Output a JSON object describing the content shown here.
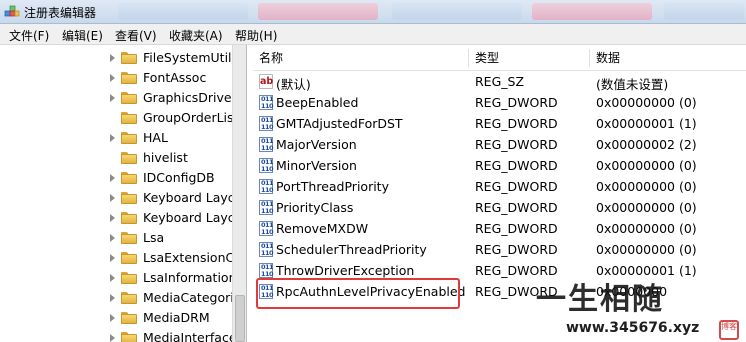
{
  "window": {
    "title": "注册表编辑器",
    "icon": "regedit-icon"
  },
  "menu": [
    "文件(F)",
    "编辑(E)",
    "查看(V)",
    "收藏夹(A)",
    "帮助(H)"
  ],
  "tree": {
    "items": [
      {
        "label": "FileSystemUtilit",
        "has_children": true
      },
      {
        "label": "FontAssoc",
        "has_children": true
      },
      {
        "label": "GraphicsDriver",
        "has_children": true
      },
      {
        "label": "GroupOrderLis",
        "has_children": false
      },
      {
        "label": "HAL",
        "has_children": true
      },
      {
        "label": "hivelist",
        "has_children": false
      },
      {
        "label": "IDConfigDB",
        "has_children": true
      },
      {
        "label": "Keyboard Layc",
        "has_children": true
      },
      {
        "label": "Keyboard Layc",
        "has_children": true
      },
      {
        "label": "Lsa",
        "has_children": true
      },
      {
        "label": "LsaExtensionCc",
        "has_children": true
      },
      {
        "label": "LsaInformation",
        "has_children": true
      },
      {
        "label": "MediaCategori",
        "has_children": true
      },
      {
        "label": "MediaDRM",
        "has_children": true
      },
      {
        "label": "MediaInterface",
        "has_children": true
      }
    ]
  },
  "list": {
    "columns": [
      "名称",
      "类型",
      "数据"
    ],
    "rows": [
      {
        "name": "(默认)",
        "type": "REG_SZ",
        "data": "(数值未设置)",
        "icon": "string-value-icon"
      },
      {
        "name": "BeepEnabled",
        "type": "REG_DWORD",
        "data": "0x00000000 (0)",
        "icon": "binary-value-icon"
      },
      {
        "name": "GMTAdjustedForDST",
        "type": "REG_DWORD",
        "data": "0x00000001 (1)",
        "icon": "binary-value-icon"
      },
      {
        "name": "MajorVersion",
        "type": "REG_DWORD",
        "data": "0x00000002 (2)",
        "icon": "binary-value-icon"
      },
      {
        "name": "MinorVersion",
        "type": "REG_DWORD",
        "data": "0x00000000 (0)",
        "icon": "binary-value-icon"
      },
      {
        "name": "PortThreadPriority",
        "type": "REG_DWORD",
        "data": "0x00000000 (0)",
        "icon": "binary-value-icon"
      },
      {
        "name": "PriorityClass",
        "type": "REG_DWORD",
        "data": "0x00000000 (0)",
        "icon": "binary-value-icon"
      },
      {
        "name": "RemoveMXDW",
        "type": "REG_DWORD",
        "data": "0x00000000 (0)",
        "icon": "binary-value-icon"
      },
      {
        "name": "SchedulerThreadPriority",
        "type": "REG_DWORD",
        "data": "0x00000000 (0)",
        "icon": "binary-value-icon"
      },
      {
        "name": "ThrowDriverException",
        "type": "REG_DWORD",
        "data": "0x00000001 (1)",
        "icon": "binary-value-icon"
      },
      {
        "name": "RpcAuthnLevelPrivacyEnabled",
        "type": "REG_DWORD",
        "data": "0x0000000",
        "icon": "binary-value-icon",
        "highlighted": true
      }
    ]
  },
  "watermark": {
    "text": "一生相随",
    "url": "www.345676.xyz",
    "seal": "博客"
  },
  "colors": {
    "highlight_border": "#e23a3a",
    "titlebar": "#c9d9ec",
    "menubar": "#f0f0f0",
    "folder": "#f0c85a"
  }
}
